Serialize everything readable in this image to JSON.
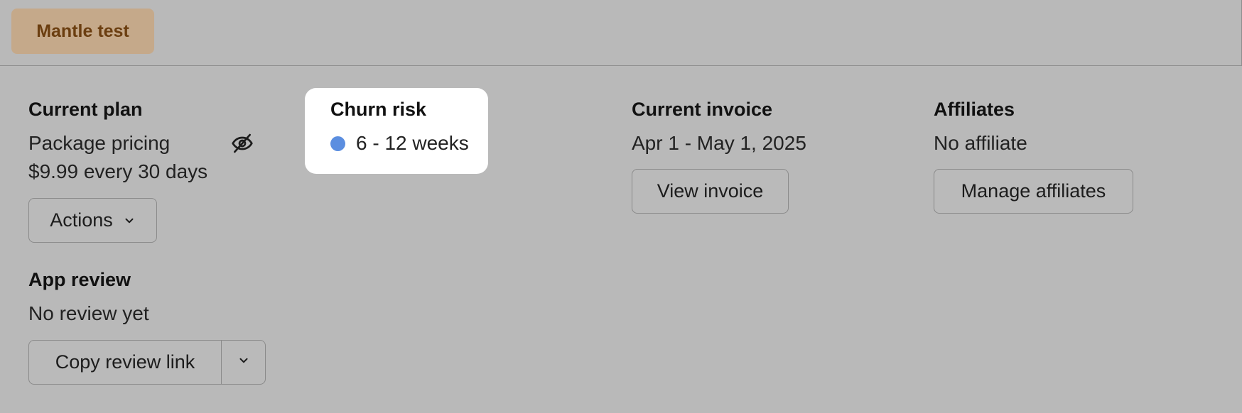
{
  "header": {
    "tag_label": "Mantle test"
  },
  "current_plan": {
    "title": "Current plan",
    "plan_name": "Package pricing",
    "price": "$9.99 every 30 days",
    "actions_label": "Actions",
    "visibility_icon": "eye-off-icon"
  },
  "churn_risk": {
    "title": "Churn risk",
    "value": "6 - 12 weeks",
    "dot_color": "#5b8ee0"
  },
  "current_invoice": {
    "title": "Current invoice",
    "period": "Apr 1 - May 1, 2025",
    "view_label": "View invoice"
  },
  "affiliates": {
    "title": "Affiliates",
    "status": "No affiliate",
    "manage_label": "Manage affiliates"
  },
  "app_review": {
    "title": "App review",
    "status": "No review yet",
    "copy_label": "Copy review link"
  },
  "colors": {
    "background": "#b9b9b9",
    "tag_bg": "#c5a98a",
    "tag_text": "#6b3e10",
    "card_bg": "#ffffff"
  }
}
